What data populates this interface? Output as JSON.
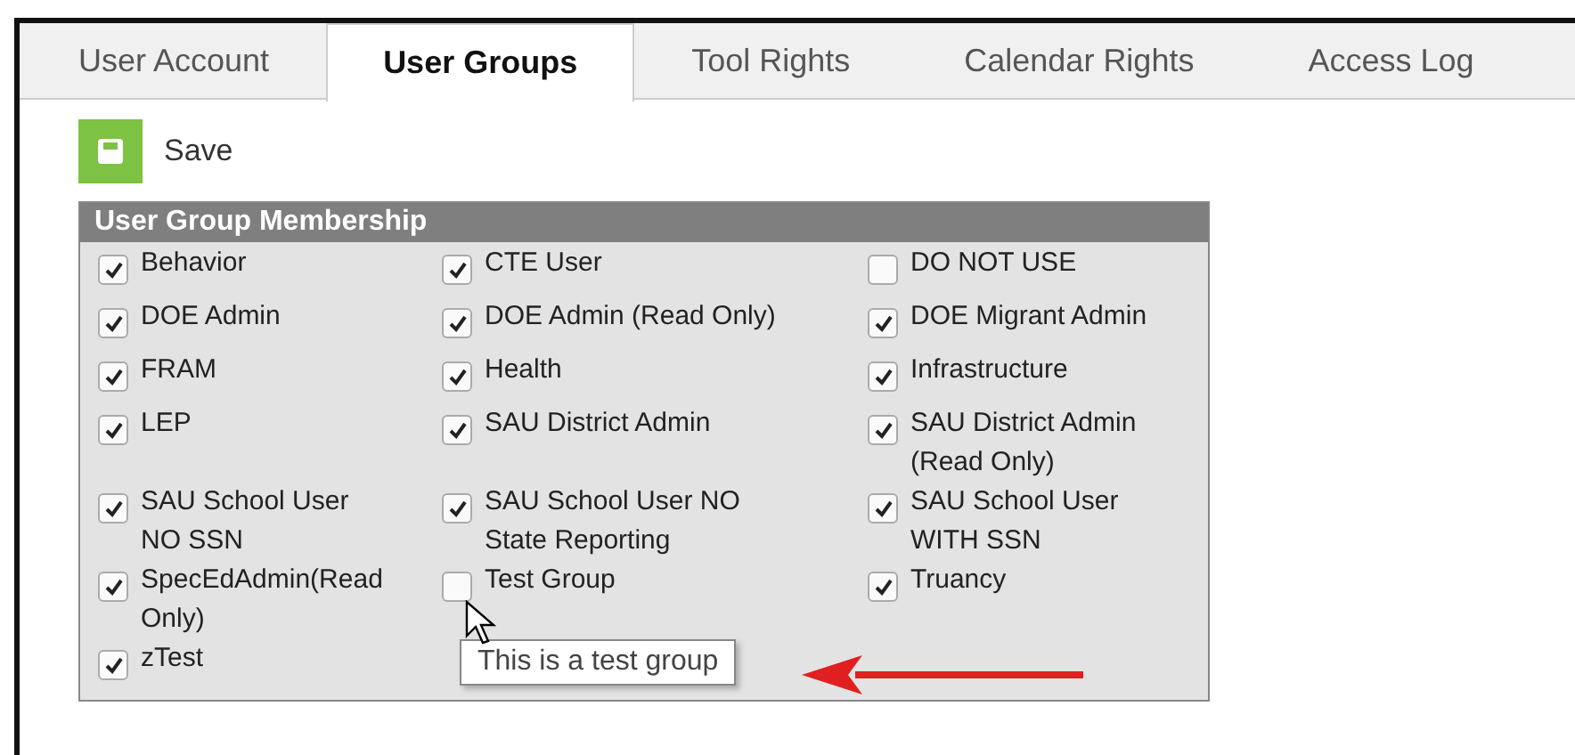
{
  "tabs": [
    {
      "label": "User Account",
      "selected": false
    },
    {
      "label": "User Groups",
      "selected": true
    },
    {
      "label": "Tool Rights",
      "selected": false
    },
    {
      "label": "Calendar Rights",
      "selected": false
    },
    {
      "label": "Access Log",
      "selected": false
    }
  ],
  "save_button": {
    "label": "Save"
  },
  "membership": {
    "title": "User Group Membership",
    "groups": [
      {
        "label": "Behavior",
        "checked": true
      },
      {
        "label": "CTE User",
        "checked": true
      },
      {
        "label": "DO NOT USE",
        "checked": false
      },
      {
        "label": "DOE Admin",
        "checked": true
      },
      {
        "label": "DOE Admin (Read Only)",
        "checked": true
      },
      {
        "label": "DOE Migrant Admin",
        "checked": true
      },
      {
        "label": "FRAM",
        "checked": true
      },
      {
        "label": "Health",
        "checked": true
      },
      {
        "label": "Infrastructure",
        "checked": true
      },
      {
        "label": "LEP",
        "checked": true
      },
      {
        "label": "SAU District Admin",
        "checked": true
      },
      {
        "label": "SAU District Admin (Read Only)",
        "checked": true
      },
      {
        "label": "SAU School User NO SSN",
        "checked": true
      },
      {
        "label": "SAU School User NO State Reporting",
        "checked": true
      },
      {
        "label": "SAU School User WITH SSN",
        "checked": true
      },
      {
        "label": "SpecEdAdmin(Read Only)",
        "checked": true
      },
      {
        "label": "Test Group",
        "checked": false
      },
      {
        "label": "Truancy",
        "checked": true
      },
      {
        "label": "zTest",
        "checked": true
      }
    ]
  },
  "tooltip": {
    "text": "This is a test group"
  }
}
